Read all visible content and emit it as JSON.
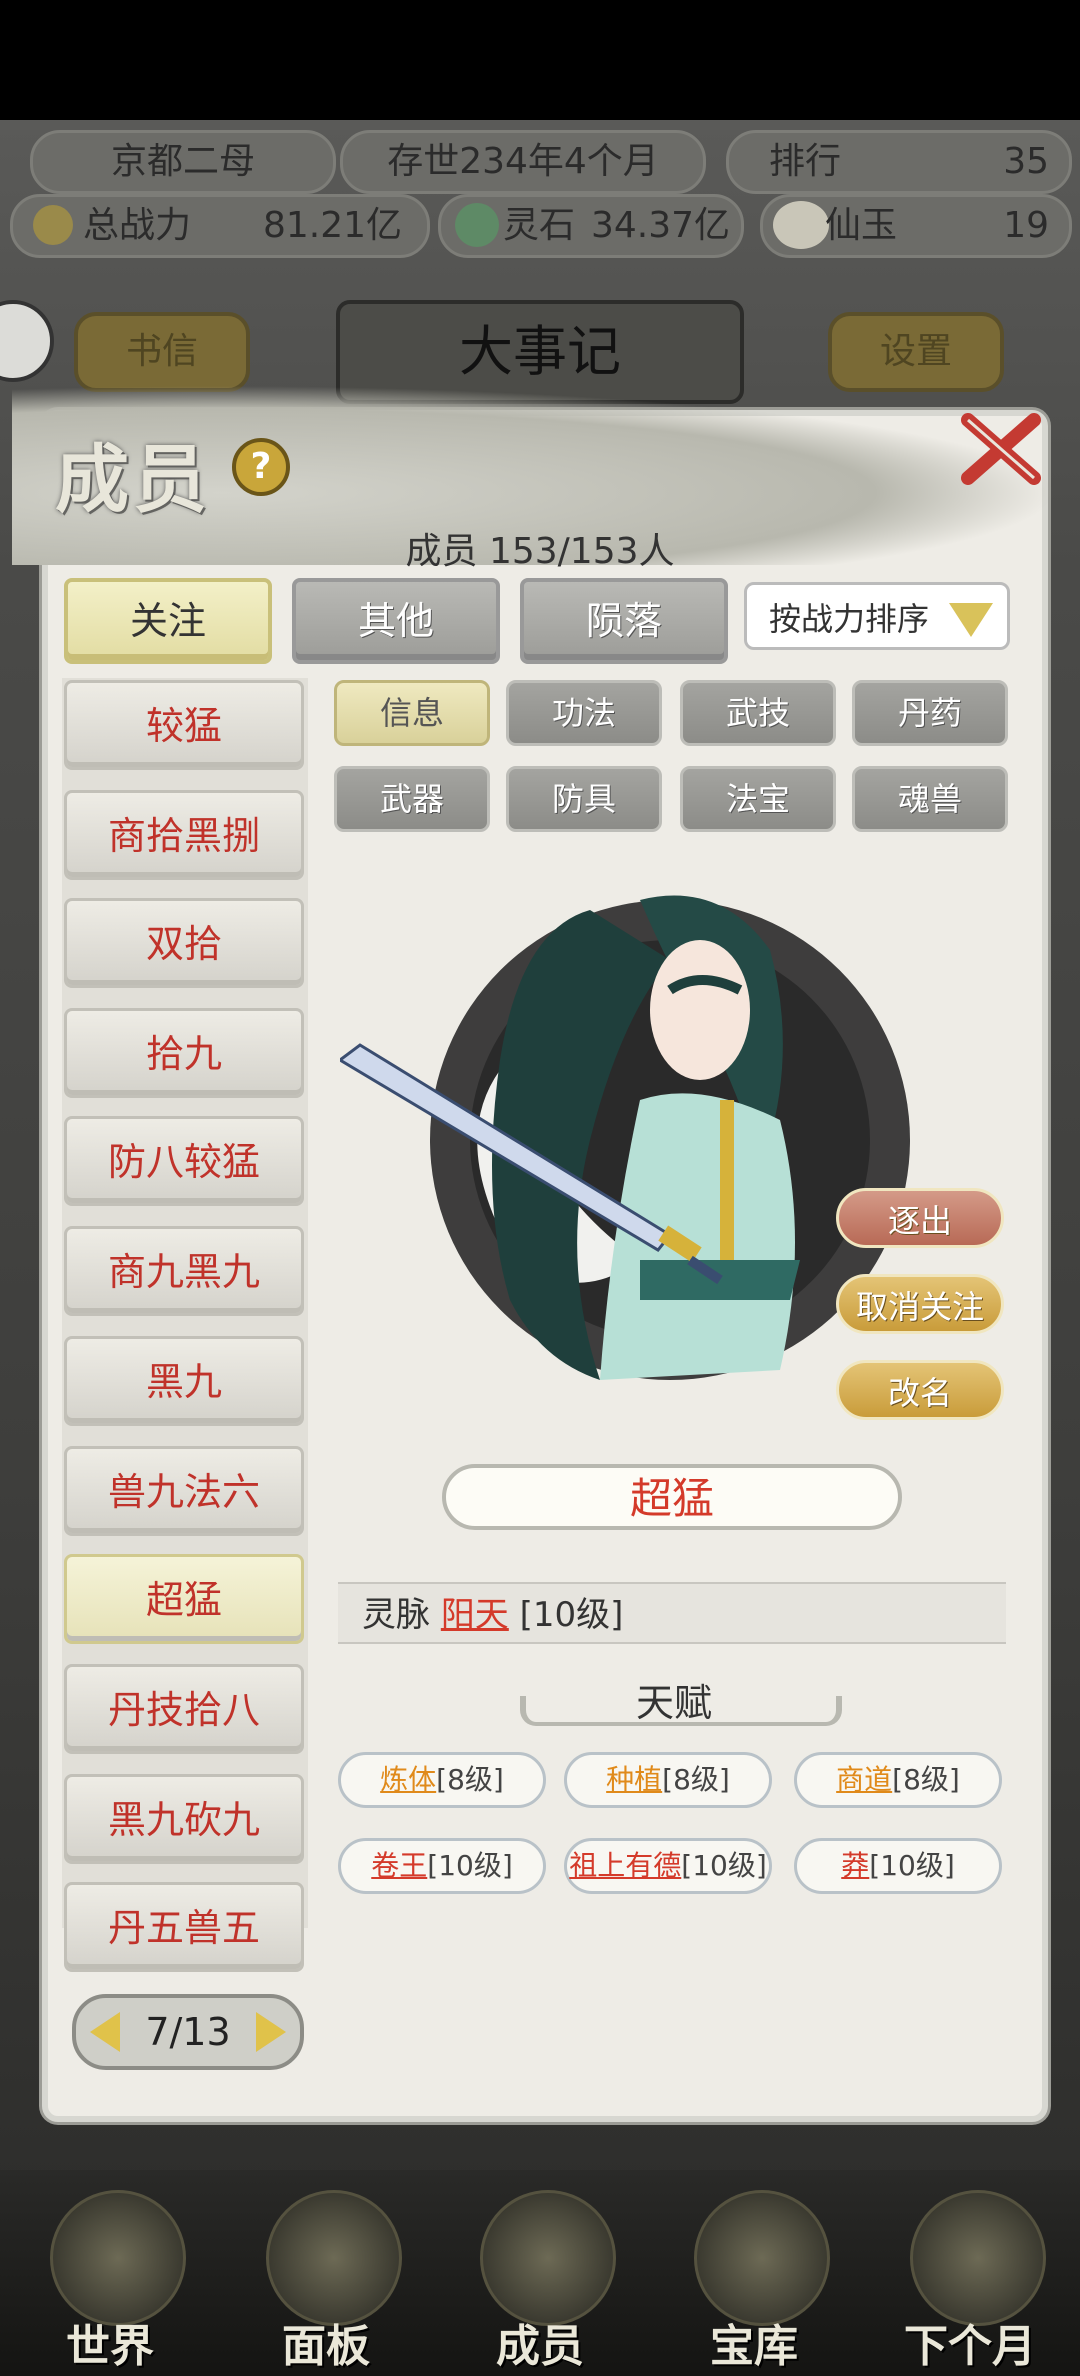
{
  "hud": {
    "location": "京都二母",
    "era": "存世234年4个月",
    "rank_label": "排行",
    "rank_value": "35",
    "power_label": "总战力",
    "power_value": "81.21亿",
    "spirit_stone_label": "灵石",
    "spirit_stone_value": "34.37亿",
    "jade_label": "仙玉",
    "jade_value": "19"
  },
  "background": {
    "mail_button": "书信",
    "events_title": "大事记",
    "settings_button": "设置"
  },
  "dialog": {
    "title": "成员",
    "member_count": "成员 153/153人",
    "tabs": [
      "关注",
      "其他",
      "陨落"
    ],
    "active_tab": 0,
    "sort_label": "按战力排序"
  },
  "member_list": {
    "items": [
      "较猛",
      "商拾黑捌",
      "双拾",
      "拾九",
      "防八较猛",
      "商九黑九",
      "黑九",
      "兽九法六",
      "超猛",
      "丹技拾八",
      "黑九砍九",
      "丹五兽五"
    ],
    "active_index": 8,
    "page": "7/13"
  },
  "sub_tabs": [
    "信息",
    "功法",
    "武技",
    "丹药",
    "武器",
    "防具",
    "法宝",
    "魂兽"
  ],
  "actions": {
    "expel": "逐出",
    "unfollow": "取消关注",
    "rename": "改名"
  },
  "member": {
    "name": "超猛",
    "vein_label": "灵脉",
    "vein_value": "阳天",
    "vein_level": "[10级]"
  },
  "talents": {
    "title": "天赋",
    "items": [
      {
        "name": "炼体",
        "level": "[8级]",
        "color": "orange"
      },
      {
        "name": "种植",
        "level": "[8级]",
        "color": "orange"
      },
      {
        "name": "商道",
        "level": "[8级]",
        "color": "orange"
      },
      {
        "name": "卷王",
        "level": "[10级]",
        "color": "red"
      },
      {
        "name": "祖上有德",
        "level": "[10级]",
        "color": "red"
      },
      {
        "name": "莽",
        "level": "[10级]",
        "color": "red"
      }
    ]
  },
  "bottom_nav": [
    "世界",
    "面板",
    "成员",
    "宝库",
    "下个月"
  ]
}
